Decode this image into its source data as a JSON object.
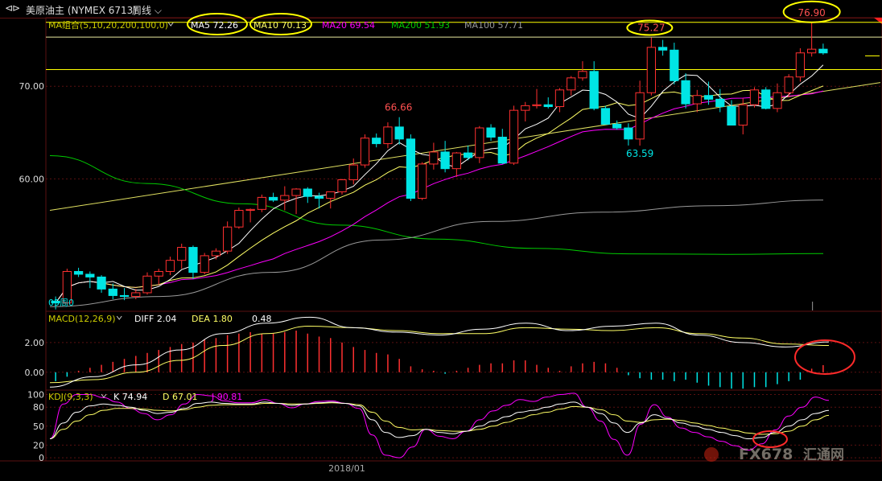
{
  "header": {
    "nav_icon": "back-forward-arrows-icon",
    "instrument": "美原油主 (NYMEX 6713)",
    "period": "周线",
    "period_icon": "chevron-down-icon"
  },
  "colors": {
    "up": "#ff3030",
    "down": "#00e5e5",
    "ma5": "#ffffff",
    "ma10": "#ffff66",
    "ma20": "#ff00ff",
    "ma200": "#00cc00",
    "ma100": "#999999",
    "grid": "#5a1010",
    "highlight": "#ffff00"
  },
  "chart_data": [
    {
      "type": "candlestick",
      "name": "price",
      "legend": [
        {
          "text": "MA组合(5,10,20,200,100,0)",
          "color": "#cccc00"
        },
        {
          "text": "MA5 72.26",
          "color": "#ffffff"
        },
        {
          "text": "MA10 70.13",
          "color": "#ffff66"
        },
        {
          "text": "MA20 69.54",
          "color": "#ff00ff"
        },
        {
          "text": "MA200 51.93",
          "color": "#00cc00"
        },
        {
          "text": "MA100 57.71",
          "color": "#999999"
        }
      ],
      "y_ticks": [
        {
          "value": 70,
          "label": "70.00"
        },
        {
          "value": 60,
          "label": "60.00"
        }
      ],
      "ylim": [
        45.7,
        77.4
      ],
      "x_label": "2018/01",
      "annotations": [
        {
          "text": "66.66",
          "value": 66.66,
          "color": "#ff5050"
        },
        {
          "text": "75.27",
          "value": 75.27,
          "color": "#ff5050"
        },
        {
          "text": "76.90",
          "value": 76.9,
          "color": "#ff5050"
        },
        {
          "text": "63.59",
          "value": 63.59,
          "color": "#00e5e5"
        },
        {
          "text": "05周0",
          "color": "#00e5e5"
        }
      ],
      "h_lines": [
        76.9,
        75.3,
        71.8
      ],
      "candles": [
        [
          46.8,
          47.3,
          45.9,
          46.6
        ],
        [
          46.6,
          50.3,
          46.4,
          50.0
        ],
        [
          50.0,
          50.4,
          49.4,
          49.7
        ],
        [
          49.7,
          50.0,
          48.2,
          49.4
        ],
        [
          49.4,
          49.6,
          47.7,
          48.1
        ],
        [
          48.1,
          48.7,
          47.0,
          47.4
        ],
        [
          47.4,
          48.2,
          46.9,
          47.3
        ],
        [
          47.3,
          48.1,
          47.0,
          47.7
        ],
        [
          47.7,
          49.9,
          47.5,
          49.5
        ],
        [
          49.5,
          50.3,
          48.6,
          50.0
        ],
        [
          50.0,
          51.6,
          49.6,
          51.2
        ],
        [
          51.2,
          53.0,
          50.3,
          52.6
        ],
        [
          52.6,
          52.8,
          49.2,
          49.9
        ],
        [
          49.9,
          52.0,
          49.7,
          51.7
        ],
        [
          51.7,
          52.5,
          51.3,
          52.2
        ],
        [
          52.2,
          55.4,
          51.9,
          54.8
        ],
        [
          54.8,
          56.9,
          54.6,
          56.6
        ],
        [
          56.6,
          56.8,
          55.3,
          56.7
        ],
        [
          56.7,
          58.3,
          56.4,
          58.0
        ],
        [
          58.0,
          58.5,
          57.5,
          57.7
        ],
        [
          57.7,
          59.2,
          56.6,
          58.2
        ],
        [
          58.2,
          59.0,
          56.2,
          58.9
        ],
        [
          58.9,
          59.1,
          57.4,
          58.1
        ],
        [
          58.1,
          58.5,
          56.8,
          57.9
        ],
        [
          57.9,
          58.5,
          56.8,
          58.6
        ],
        [
          58.6,
          60.0,
          58.3,
          59.9
        ],
        [
          59.9,
          62.2,
          59.4,
          61.5
        ],
        [
          61.5,
          64.8,
          61.2,
          64.4
        ],
        [
          64.4,
          64.9,
          63.4,
          63.8
        ],
        [
          63.8,
          66.1,
          63.3,
          65.6
        ],
        [
          65.6,
          66.66,
          63.7,
          64.3
        ],
        [
          64.3,
          64.8,
          57.6,
          57.9
        ],
        [
          57.9,
          61.8,
          57.7,
          61.6
        ],
        [
          61.6,
          63.9,
          61.0,
          62.9
        ],
        [
          62.9,
          64.1,
          60.7,
          61.1
        ],
        [
          61.1,
          62.9,
          60.2,
          62.8
        ],
        [
          62.8,
          63.6,
          62.0,
          62.3
        ],
        [
          62.3,
          65.7,
          61.7,
          65.5
        ],
        [
          65.5,
          65.9,
          64.1,
          64.5
        ],
        [
          64.5,
          65.4,
          61.6,
          61.7
        ],
        [
          61.7,
          67.9,
          61.5,
          67.4
        ],
        [
          67.4,
          68.3,
          66.2,
          67.9
        ],
        [
          67.9,
          69.7,
          67.6,
          68.0
        ],
        [
          68.0,
          68.8,
          67.6,
          67.8
        ],
        [
          67.8,
          69.8,
          67.2,
          69.6
        ],
        [
          69.6,
          71.1,
          69.0,
          70.9
        ],
        [
          70.9,
          72.7,
          70.6,
          71.6
        ],
        [
          71.6,
          72.7,
          67.4,
          67.6
        ],
        [
          67.6,
          67.9,
          65.9,
          65.9
        ],
        [
          65.9,
          66.3,
          65.3,
          65.5
        ],
        [
          65.5,
          66.0,
          63.6,
          64.3
        ],
        [
          64.3,
          70.6,
          63.59,
          69.3
        ],
        [
          69.3,
          75.27,
          69.0,
          74.2
        ],
        [
          74.2,
          75.0,
          73.3,
          73.9
        ],
        [
          73.9,
          74.7,
          70.2,
          70.6
        ],
        [
          70.6,
          71.4,
          67.6,
          68.1
        ],
        [
          68.1,
          69.6,
          67.2,
          69.0
        ],
        [
          69.0,
          70.5,
          68.0,
          68.6
        ],
        [
          68.6,
          69.7,
          67.2,
          67.8
        ],
        [
          67.8,
          68.5,
          65.8,
          65.8
        ],
        [
          65.8,
          68.7,
          64.8,
          68.0
        ],
        [
          68.0,
          69.9,
          67.7,
          69.6
        ],
        [
          69.6,
          69.9,
          67.5,
          67.6
        ],
        [
          67.6,
          70.3,
          67.2,
          69.3
        ],
        [
          69.3,
          71.3,
          68.8,
          71.0
        ],
        [
          71.0,
          74.1,
          70.5,
          73.6
        ],
        [
          73.6,
          76.9,
          73.2,
          74.0
        ],
        [
          74.0,
          74.6,
          73.4,
          73.6
        ]
      ],
      "ma200": [
        62.5,
        59.5,
        57.3,
        55.0,
        53.5,
        52.5,
        51.9,
        51.85,
        51.93
      ],
      "ma100": [
        46.2,
        47.3,
        49.9,
        53.4,
        55.4,
        56.4,
        57.1,
        57.71
      ],
      "trendline": [
        56.6,
        70.4
      ]
    },
    {
      "type": "bar",
      "name": "MACD",
      "legend": [
        {
          "text": "MACD(12,26,9)",
          "color": "#cccc00"
        },
        {
          "text": "DIFF 2.04",
          "color": "#ffffff"
        },
        {
          "text": "DEA 1.80",
          "color": "#ffff66"
        },
        {
          "text": "0.48",
          "color": "#ffffff"
        }
      ],
      "y_ticks": [
        {
          "value": 2,
          "label": "2.00"
        },
        {
          "value": 0,
          "label": "0.00"
        }
      ],
      "ylim": [
        -1.2,
        4.1
      ],
      "diff": [
        -1.0,
        -0.3,
        0.5,
        1.5,
        2.6,
        3.3,
        3.7,
        3.0,
        2.7,
        2.5,
        2.9,
        3.3,
        2.8,
        3.1,
        3.3,
        2.5,
        2.0,
        1.7,
        2.04
      ],
      "dea": [
        -0.7,
        -0.5,
        0.0,
        0.8,
        1.8,
        2.6,
        3.1,
        3.0,
        2.8,
        2.6,
        2.6,
        3.0,
        2.9,
        2.8,
        3.0,
        2.6,
        2.3,
        1.9,
        1.8
      ],
      "histogram": [
        -0.6,
        -0.3,
        0.1,
        0.3,
        0.5,
        0.7,
        0.9,
        1.1,
        1.3,
        1.5,
        1.7,
        1.9,
        2.0,
        2.2,
        2.3,
        2.5,
        2.6,
        2.7,
        2.6,
        2.6,
        2.7,
        2.8,
        2.6,
        2.4,
        2.3,
        2.0,
        1.7,
        1.5,
        1.3,
        1.2,
        0.9,
        0.4,
        0.2,
        0.1,
        -0.1,
        0.1,
        0.3,
        0.5,
        0.6,
        0.6,
        0.8,
        0.8,
        0.5,
        0.3,
        0.1,
        0.4,
        0.6,
        0.7,
        0.6,
        0.3,
        -0.2,
        -0.4,
        -0.5,
        -0.5,
        -0.6,
        -0.5,
        -0.7,
        -0.9,
        -1.0,
        -1.1,
        -1.1,
        -1.0,
        -1.0,
        -0.8,
        -0.6,
        -0.5,
        0.24,
        0.48
      ]
    },
    {
      "type": "line",
      "name": "KDJ",
      "legend": [
        {
          "text": "KDJ(9,3,3)",
          "color": "#cccc00"
        },
        {
          "text": "K 74.94",
          "color": "#ffffff"
        },
        {
          "text": "D 67.01",
          "color": "#ffff66"
        },
        {
          "text": "J 90.81",
          "color": "#ff00ff"
        }
      ],
      "y_ticks": [
        {
          "value": 100,
          "label": "100"
        },
        {
          "value": 80,
          "label": "80"
        },
        {
          "value": 50,
          "label": "50"
        },
        {
          "value": 20,
          "label": "20"
        },
        {
          "value": 0,
          "label": "0"
        }
      ],
      "ylim": [
        -5,
        107
      ],
      "K": [
        30,
        55,
        72,
        82,
        85,
        83,
        80,
        75,
        70,
        72,
        78,
        86,
        88,
        86,
        85,
        85,
        88,
        86,
        83,
        85,
        87,
        88,
        86,
        82,
        60,
        40,
        32,
        35,
        45,
        40,
        38,
        42,
        50,
        58,
        65,
        72,
        75,
        80,
        85,
        88,
        80,
        70,
        55,
        40,
        55,
        68,
        62,
        55,
        50,
        45,
        40,
        35,
        30,
        32,
        40,
        50,
        60,
        70,
        74.94
      ],
      "D": [
        30,
        45,
        58,
        68,
        75,
        78,
        78,
        77,
        75,
        74,
        76,
        80,
        83,
        84,
        84,
        84,
        86,
        86,
        85,
        85,
        86,
        87,
        86,
        84,
        72,
        58,
        48,
        44,
        45,
        43,
        42,
        42,
        45,
        50,
        56,
        62,
        68,
        72,
        77,
        81,
        80,
        76,
        68,
        58,
        56,
        60,
        61,
        59,
        55,
        51,
        47,
        43,
        39,
        37,
        38,
        42,
        50,
        60,
        67.01
      ],
      "J": [
        30,
        85,
        100,
        100,
        95,
        88,
        78,
        70,
        60,
        68,
        85,
        100,
        98,
        90,
        87,
        87,
        92,
        86,
        79,
        85,
        89,
        90,
        86,
        78,
        36,
        4,
        0,
        17,
        45,
        34,
        30,
        42,
        60,
        74,
        83,
        92,
        89,
        96,
        100,
        102,
        80,
        58,
        29,
        4,
        53,
        84,
        64,
        47,
        40,
        33,
        26,
        19,
        12,
        22,
        44,
        66,
        80,
        96,
        90.81
      ]
    }
  ],
  "watermark": {
    "logo_icon": "fx678-logo-icon",
    "text": "FX678",
    "text2": "汇通网"
  }
}
